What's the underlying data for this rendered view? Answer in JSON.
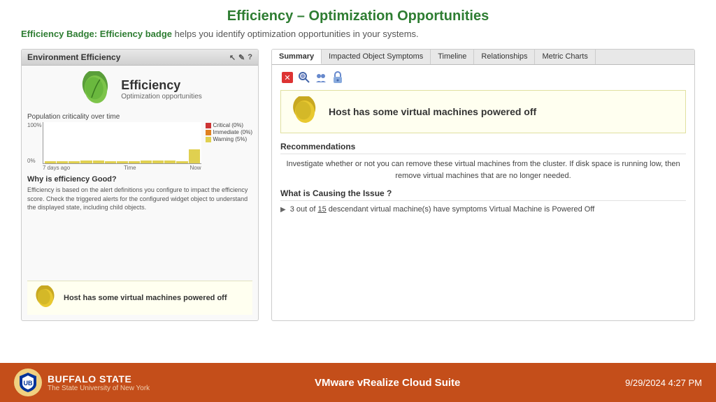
{
  "page": {
    "title": "Efficiency – Optimization Opportunities",
    "subtitle_bold": "Efficiency Badge: Efficiency badge",
    "subtitle_rest": " helps you identify optimization opportunities in your systems."
  },
  "left_panel": {
    "header": "Environment Efficiency",
    "header_icons": [
      "↖",
      "✎",
      "?"
    ],
    "efficiency_label": "Efficiency",
    "efficiency_sub": "Optimization opportunities",
    "chart_title": "Population criticality over time",
    "chart_y_top": "100%",
    "chart_y_bottom": "0%",
    "chart_x_labels": [
      "7 days ago",
      "Time",
      "Now"
    ],
    "legend": [
      {
        "label": "Critical (0%)",
        "color": "#cc3333"
      },
      {
        "label": "Immediate (0%)",
        "color": "#e08020"
      },
      {
        "label": "Warning (5%)",
        "color": "#e0d050"
      }
    ],
    "why_title": "Why is efficiency Good?",
    "why_text": "Efficiency is based on the alert definitions you configure to impact the efficiency score. Check the triggered alerts for the configured widget object to understand the displayed state, including child objects.",
    "alert_text": "Host has some virtual machines powered off"
  },
  "right_panel": {
    "tabs": [
      "Summary",
      "Impacted Object Symptoms",
      "Timeline",
      "Relationships",
      "Metric Charts"
    ],
    "active_tab": "Summary",
    "icons": [
      "✖",
      "🔍",
      "👥",
      "🔒"
    ],
    "alert_banner_text": "Host has some virtual machines powered off",
    "recommendations_title": "Recommendations",
    "recommendations_text": "Investigate whether or not you can remove these virtual machines from the cluster. If disk space is running low, then remove virtual machines that are no longer needed.",
    "causing_title": "What is Causing the Issue ?",
    "causing_text": "3 out of 15 descendant virtual machine(s) have symptoms Virtual Machine is Powered Off",
    "causing_underline_end": 15
  },
  "footer": {
    "university": "Buffalo State",
    "suny": "The State University of New York",
    "center": "VMware vRealize Cloud Suite",
    "date": "9/29/2024 4:27 PM"
  }
}
